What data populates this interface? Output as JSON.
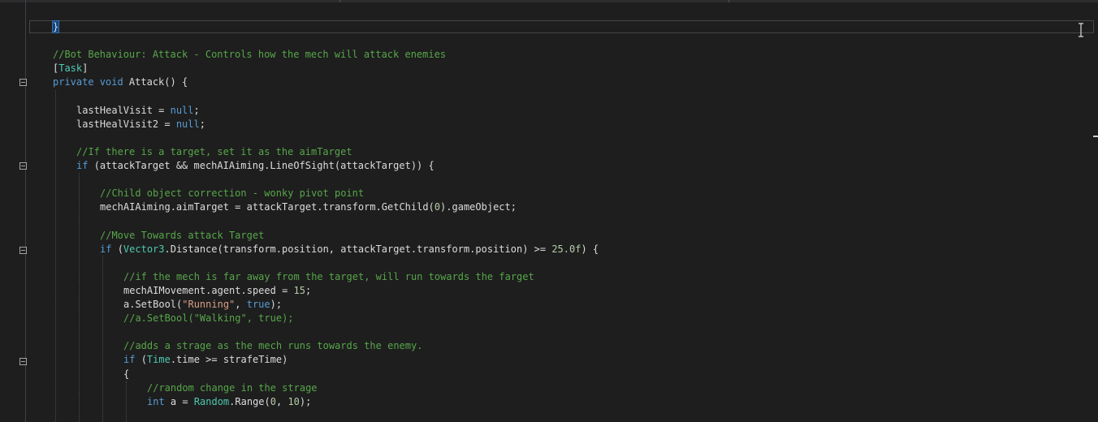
{
  "editor": {
    "lines": [
      {
        "indent": 1,
        "tokens": [
          {
            "t": "}",
            "c": "brace-hl"
          }
        ]
      },
      {
        "indent": 0,
        "tokens": []
      },
      {
        "indent": 1,
        "tokens": [
          {
            "t": "//Bot Behaviour: Attack - Controls how the mech will attack enemies",
            "c": "cm"
          }
        ]
      },
      {
        "indent": 1,
        "tokens": [
          {
            "t": "[",
            "c": "tx"
          },
          {
            "t": "Task",
            "c": "ty"
          },
          {
            "t": "]",
            "c": "tx"
          }
        ]
      },
      {
        "indent": 1,
        "tokens": [
          {
            "t": "private ",
            "c": "kw"
          },
          {
            "t": "void ",
            "c": "kw"
          },
          {
            "t": "Attack() {",
            "c": "tx"
          }
        ]
      },
      {
        "indent": 0,
        "tokens": []
      },
      {
        "indent": 2,
        "tokens": [
          {
            "t": "lastHealVisit = ",
            "c": "tx"
          },
          {
            "t": "null",
            "c": "kw"
          },
          {
            "t": ";",
            "c": "tx"
          }
        ]
      },
      {
        "indent": 2,
        "tokens": [
          {
            "t": "lastHealVisit2 = ",
            "c": "tx"
          },
          {
            "t": "null",
            "c": "kw"
          },
          {
            "t": ";",
            "c": "tx"
          }
        ]
      },
      {
        "indent": 0,
        "tokens": []
      },
      {
        "indent": 2,
        "tokens": [
          {
            "t": "//If there is a target, set it as the aimTarget",
            "c": "cm"
          }
        ]
      },
      {
        "indent": 2,
        "tokens": [
          {
            "t": "if ",
            "c": "kw"
          },
          {
            "t": "(attackTarget && mechAIAiming.LineOfSight(attackTarget)) {",
            "c": "tx"
          }
        ]
      },
      {
        "indent": 0,
        "tokens": []
      },
      {
        "indent": 3,
        "tokens": [
          {
            "t": "//Child object correction - wonky pivot point",
            "c": "cm"
          }
        ]
      },
      {
        "indent": 3,
        "tokens": [
          {
            "t": "mechAIAiming.aimTarget = attackTarget.transform.GetChild(",
            "c": "tx"
          },
          {
            "t": "0",
            "c": "nu"
          },
          {
            "t": ").gameObject;",
            "c": "tx"
          }
        ]
      },
      {
        "indent": 0,
        "tokens": []
      },
      {
        "indent": 3,
        "tokens": [
          {
            "t": "//Move Towards attack Target",
            "c": "cm"
          }
        ]
      },
      {
        "indent": 3,
        "tokens": [
          {
            "t": "if ",
            "c": "kw"
          },
          {
            "t": "(",
            "c": "tx"
          },
          {
            "t": "Vector3",
            "c": "ty"
          },
          {
            "t": ".Distance(transform.position, attackTarget.transform.position) >= ",
            "c": "tx"
          },
          {
            "t": "25.0f",
            "c": "nu"
          },
          {
            "t": ") {",
            "c": "tx"
          }
        ]
      },
      {
        "indent": 0,
        "tokens": []
      },
      {
        "indent": 4,
        "tokens": [
          {
            "t": "//if the mech is far away from the target, will run towards the farget",
            "c": "cm"
          }
        ]
      },
      {
        "indent": 4,
        "tokens": [
          {
            "t": "mechAIMovement.agent.speed = ",
            "c": "tx"
          },
          {
            "t": "15",
            "c": "nu"
          },
          {
            "t": ";",
            "c": "tx"
          }
        ]
      },
      {
        "indent": 4,
        "tokens": [
          {
            "t": "a.SetBool(",
            "c": "tx"
          },
          {
            "t": "\"Running\"",
            "c": "st"
          },
          {
            "t": ", ",
            "c": "tx"
          },
          {
            "t": "true",
            "c": "kw"
          },
          {
            "t": ");",
            "c": "tx"
          }
        ]
      },
      {
        "indent": 4,
        "tokens": [
          {
            "t": "//a.SetBool(\"Walking\", true);",
            "c": "cm"
          }
        ]
      },
      {
        "indent": 0,
        "tokens": []
      },
      {
        "indent": 4,
        "tokens": [
          {
            "t": "//adds a strage as the mech runs towards the enemy.",
            "c": "cm"
          }
        ]
      },
      {
        "indent": 4,
        "tokens": [
          {
            "t": "if ",
            "c": "kw"
          },
          {
            "t": "(",
            "c": "tx"
          },
          {
            "t": "Time",
            "c": "ty"
          },
          {
            "t": ".time >= strafeTime)",
            "c": "tx"
          }
        ]
      },
      {
        "indent": 4,
        "tokens": [
          {
            "t": "{",
            "c": "tx"
          }
        ]
      },
      {
        "indent": 5,
        "tokens": [
          {
            "t": "//random change in the strage",
            "c": "cm"
          }
        ]
      },
      {
        "indent": 5,
        "tokens": [
          {
            "t": "int ",
            "c": "kw"
          },
          {
            "t": "a = ",
            "c": "tx"
          },
          {
            "t": "Random",
            "c": "ty"
          },
          {
            "t": ".Range(",
            "c": "tx"
          },
          {
            "t": "0",
            "c": "nu"
          },
          {
            "t": ", ",
            "c": "tx"
          },
          {
            "t": "10",
            "c": "nu"
          },
          {
            "t": ");",
            "c": "tx"
          }
        ]
      }
    ]
  }
}
